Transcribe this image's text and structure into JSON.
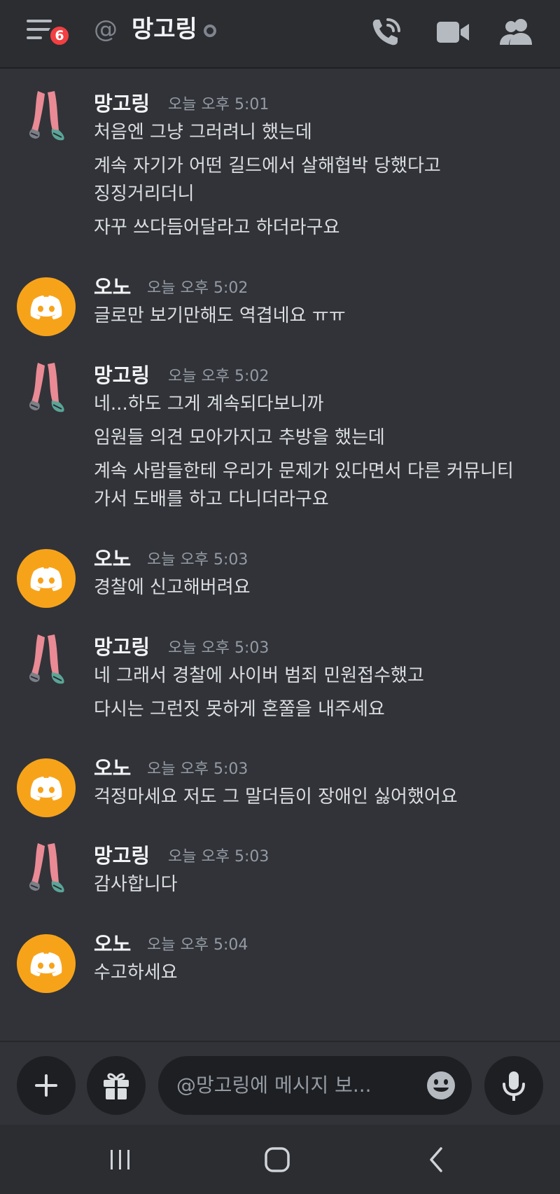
{
  "header": {
    "menu_badge": "6",
    "at_symbol": "@",
    "channel_name": "망고링",
    "icons": [
      "hamburger-menu-icon",
      "phone-call-icon",
      "video-camera-icon",
      "members-icon"
    ]
  },
  "messages": [
    {
      "author": "망고링",
      "avatar": "legs",
      "time": "오늘 오후 5:01",
      "lines": [
        "처음엔 그냥 그러려니 했는데",
        "계속 자기가 어떤 길드에서 살해협박 당했다고",
        "징징거리더니",
        "자꾸 쓰다듬어달라고 하더라구요"
      ]
    },
    {
      "author": "오노",
      "avatar": "discord",
      "time": "오늘 오후 5:02",
      "lines": [
        "글로만 보기만해도 역겹네요 ㅠㅠ"
      ]
    },
    {
      "author": "망고링",
      "avatar": "legs",
      "time": "오늘 오후 5:02",
      "lines": [
        "네...하도 그게 계속되다보니까",
        "임원들 의견 모아가지고 추방을 했는데",
        "계속 사람들한테 우리가 문제가 있다면서 다른 커뮤니티",
        "가서 도배를 하고 다니더라구요"
      ]
    },
    {
      "author": "오노",
      "avatar": "discord",
      "time": "오늘 오후 5:03",
      "lines": [
        "경찰에 신고해버려요"
      ]
    },
    {
      "author": "망고링",
      "avatar": "legs",
      "time": "오늘 오후 5:03",
      "lines": [
        "네 그래서 경찰에 사이버 범죄 민원접수했고",
        "다시는 그런짓 못하게 혼쭐을 내주세요"
      ]
    },
    {
      "author": "오노",
      "avatar": "discord",
      "time": "오늘 오후 5:03",
      "lines": [
        "걱정마세요 저도 그 말더듬이 장애인 싫어했어요"
      ]
    },
    {
      "author": "망고링",
      "avatar": "legs",
      "time": "오늘 오후 5:03",
      "lines": [
        "감사합니다"
      ]
    },
    {
      "author": "오노",
      "avatar": "discord",
      "time": "오늘 오후 5:04",
      "lines": [
        "수고하세요"
      ]
    }
  ],
  "composer": {
    "placeholder": "@망고링에 메시지 보...",
    "icons": [
      "plus-icon",
      "gift-icon",
      "emoji-icon",
      "microphone-icon"
    ]
  },
  "navbar": {
    "icons": [
      "recent-apps-icon",
      "home-icon",
      "back-icon"
    ]
  },
  "colors": {
    "background": "#313338",
    "header": "#2b2d31",
    "input": "#1e1f22",
    "badge": "#f23f42",
    "discord_avatar": "#f7a31a",
    "timestamp": "#949ba4"
  }
}
